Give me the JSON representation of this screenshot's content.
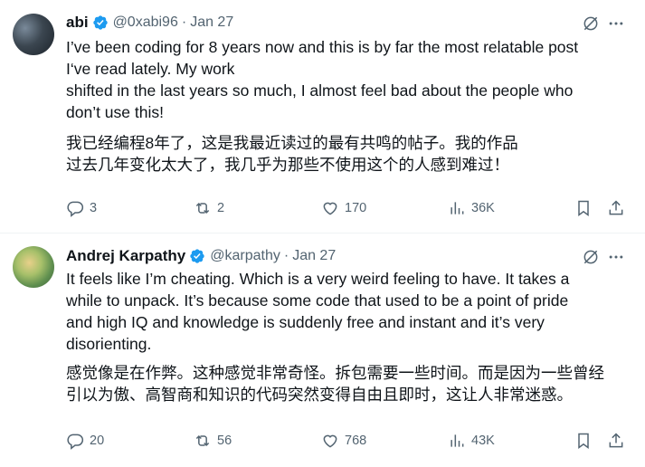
{
  "posts": [
    {
      "author": "abi",
      "handle": "@0xabi96",
      "separator": "·",
      "date": "Jan 27",
      "text_en": [
        "I’ve been coding for 8 years now and this is by far the most relatable post",
        "I‘ve read lately. My work",
        "shifted in the last years so much, I almost feel bad about the people who",
        "don’t use this!"
      ],
      "text_zh": [
        "我已经编程8年了，这是我最近读过的最有共鸣的帖子。我的作品",
        "过去几年变化太大了，我几乎为那些不使用这个的人感到难过！"
      ],
      "stats": {
        "replies": "3",
        "reposts": "2",
        "likes": "170",
        "views": "36K"
      }
    },
    {
      "author": "Andrej Karpathy",
      "handle": "@karpathy",
      "separator": "·",
      "date": "Jan 27",
      "text_en": [
        "It feels like I’m cheating. Which is a very weird feeling to have. It takes a",
        "while to unpack. It’s because some code that used to be a point of pride",
        "and high IQ and knowledge is suddenly free and instant and it’s very",
        "disorienting."
      ],
      "text_zh": [
        "感觉像是在作弊。这种感觉非常奇怪。拆包需要一些时间。而是因为一些曾经",
        "引以为傲、高智商和知识的代码突然变得自由且即时，这让人非常迷惑。"
      ],
      "stats": {
        "replies": "20",
        "reposts": "56",
        "likes": "768",
        "views": "43K"
      }
    }
  ],
  "icons": {
    "verified": "verified-badge-icon",
    "grok": "grok-icon",
    "more": "more-icon",
    "reply": "reply-icon",
    "repost": "repost-icon",
    "like": "heart-icon",
    "views": "views-icon",
    "bookmark": "bookmark-icon",
    "share": "share-icon"
  },
  "colors": {
    "text": "#0f1419",
    "secondary": "#536471",
    "verified": "#1d9bf0",
    "divider": "#eff3f4"
  }
}
